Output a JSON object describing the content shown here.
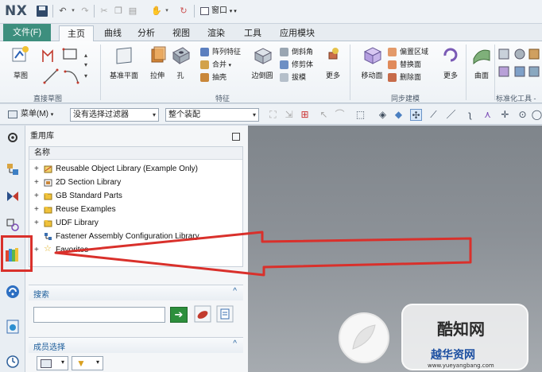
{
  "app": {
    "logo": "NX",
    "window_menu": "窗口"
  },
  "tabs": [
    {
      "label": "文件(F)"
    },
    {
      "label": "主页"
    },
    {
      "label": "曲线"
    },
    {
      "label": "分析"
    },
    {
      "label": "视图"
    },
    {
      "label": "渲染"
    },
    {
      "label": "工具"
    },
    {
      "label": "应用模块"
    }
  ],
  "ribbon": {
    "sketch_group": {
      "label": "直接草图",
      "sketch_button": "草图"
    },
    "feature_group": {
      "label": "特征",
      "datum_plane": "基准平面",
      "extrude": "拉伸",
      "hole": "孔",
      "pattern_feature": "阵列特征",
      "unite": "合并",
      "shell": "抽壳",
      "edge_blend": "边倒圆",
      "chamfer": "倒斜角",
      "trim_body": "修剪体",
      "draft": "拔模",
      "more": "更多"
    },
    "sync_group": {
      "label": "同步建模",
      "move_face": "移动面",
      "offset_region": "偏置区域",
      "replace_face": "替换面",
      "delete_face": "删除面",
      "more": "更多"
    },
    "surface_group": {
      "surface": "曲面"
    },
    "standard_group": {
      "label": "标准化工具 -"
    }
  },
  "command_bar": {
    "menu_label": "菜单(M)",
    "filter_value": "没有选择过滤器",
    "assembly_value": "整个装配"
  },
  "reuse_library": {
    "title": "重用库",
    "column_name": "名称",
    "items": [
      {
        "label": "Reusable Object Library (Example Only)"
      },
      {
        "label": "2D Section Library"
      },
      {
        "label": "GB Standard Parts"
      },
      {
        "label": "Reuse Examples"
      },
      {
        "label": "UDF Library"
      },
      {
        "label": "Fastener Assembly Configuration Library"
      },
      {
        "label": "Favorites"
      }
    ],
    "search_label": "搜索",
    "member_select_label": "成员选择"
  },
  "watermark": {
    "title": "酷知网",
    "subtitle": "越华资网",
    "url": "www.yueyangbang.com"
  },
  "colors": {
    "file_tab": "#3d8f7e",
    "annotation_red": "#d9302b",
    "section_text": "#1b5c9a"
  }
}
